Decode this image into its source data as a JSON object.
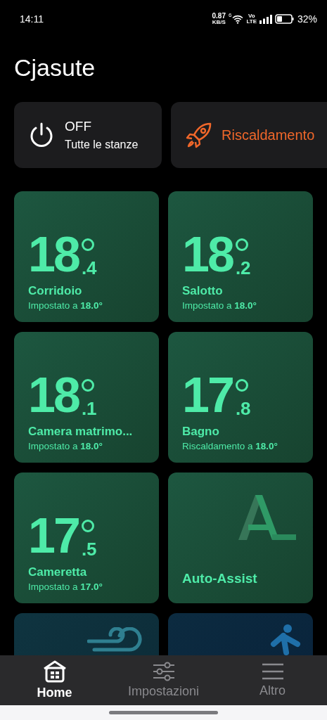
{
  "status_bar": {
    "time": "14:11",
    "net_speed": "0.87",
    "net_unit": "KB/S",
    "wifi_label": "6",
    "volte_top": "Vo",
    "volte_bottom": "LTE",
    "battery": "32%"
  },
  "title": "Cjasute",
  "quick_actions": [
    {
      "kind": "power",
      "title": "OFF",
      "subtitle": "Tutte le stanze"
    },
    {
      "kind": "boost",
      "title": "Riscaldamento"
    }
  ],
  "tiles": [
    {
      "kind": "room",
      "whole": "18",
      "decimal": ".4",
      "name": "Corridoio",
      "detail": "Impostato a **18.0°**"
    },
    {
      "kind": "room",
      "whole": "18",
      "decimal": ".2",
      "name": "Salotto",
      "detail": "Impostato a **18.0°**"
    },
    {
      "kind": "room",
      "whole": "18",
      "decimal": ".1",
      "name": "Camera matrimo...",
      "detail": "Impostato a **18.0°**"
    },
    {
      "kind": "room",
      "whole": "17",
      "decimal": ".8",
      "name": "Bagno",
      "detail": "Riscaldamento a **18.0°**"
    },
    {
      "kind": "room",
      "whole": "17",
      "decimal": ".5",
      "name": "Cameretta",
      "detail": "Impostato a **17.0°**"
    },
    {
      "kind": "assist",
      "name": "Auto-Assist"
    },
    {
      "kind": "wind"
    },
    {
      "kind": "motion"
    }
  ],
  "nav": [
    {
      "kind": "home",
      "label": "Home",
      "selected": true
    },
    {
      "kind": "settings",
      "label": "Impostazioni",
      "selected": false
    },
    {
      "kind": "menu",
      "label": "Altro",
      "selected": false
    }
  ]
}
